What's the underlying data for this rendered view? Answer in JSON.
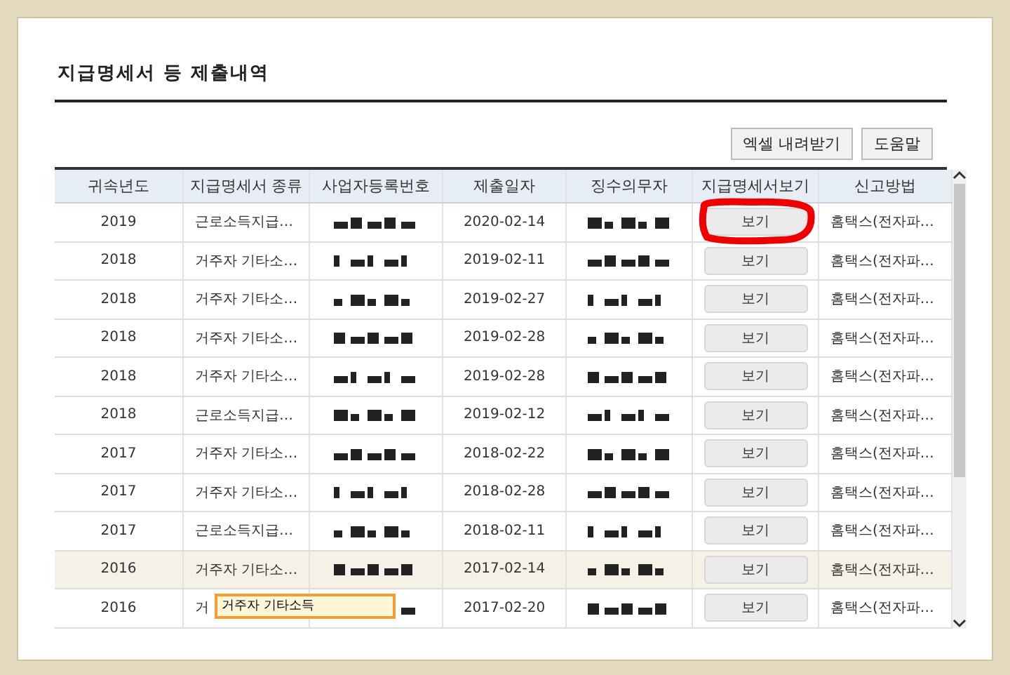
{
  "title": "지급명세서 등 제출내역",
  "buttons": [
    "엑셀 내려받기",
    "도움말"
  ],
  "table": {
    "columns": [
      "귀속년도",
      "지급명세서 종류",
      "사업자등록번호",
      "제출일자",
      "징수의무자",
      "지급명세서보기",
      "신고방법"
    ],
    "rows": [
      {
        "year": "2019",
        "type": "근로소득지급…",
        "date": "2020-02-14",
        "view": "보기",
        "method": "홈택스(전자파…",
        "highlighted": false,
        "circled": true
      },
      {
        "year": "2018",
        "type": "거주자 기타소…",
        "date": "2019-02-11",
        "view": "보기",
        "method": "홈택스(전자파…",
        "highlighted": false,
        "circled": false
      },
      {
        "year": "2018",
        "type": "거주자 기타소…",
        "date": "2019-02-27",
        "view": "보기",
        "method": "홈택스(전자파…",
        "highlighted": false,
        "circled": false
      },
      {
        "year": "2018",
        "type": "거주자 기타소…",
        "date": "2019-02-28",
        "view": "보기",
        "method": "홈택스(전자파…",
        "highlighted": false,
        "circled": false
      },
      {
        "year": "2018",
        "type": "거주자 기타소…",
        "date": "2019-02-28",
        "view": "보기",
        "method": "홈택스(전자파…",
        "highlighted": false,
        "circled": false
      },
      {
        "year": "2018",
        "type": "근로소득지급…",
        "date": "2019-02-12",
        "view": "보기",
        "method": "홈택스(전자파…",
        "highlighted": false,
        "circled": false
      },
      {
        "year": "2017",
        "type": "거주자 기타소…",
        "date": "2018-02-22",
        "view": "보기",
        "method": "홈택스(전자파…",
        "highlighted": false,
        "circled": false
      },
      {
        "year": "2017",
        "type": "거주자 기타소…",
        "date": "2018-02-28",
        "view": "보기",
        "method": "홈택스(전자파…",
        "highlighted": false,
        "circled": false
      },
      {
        "year": "2017",
        "type": "근로소득지급…",
        "date": "2018-02-11",
        "view": "보기",
        "method": "홈택스(전자파…",
        "highlighted": false,
        "circled": false
      },
      {
        "year": "2016",
        "type": "거주자 기타소…",
        "date": "2017-02-14",
        "view": "보기",
        "method": "홈택스(전자파…",
        "highlighted": true,
        "circled": false
      },
      {
        "year": "2016",
        "type": "거",
        "date": "2017-02-20",
        "view": "보기",
        "method": "홈택스(전자파…",
        "highlighted": false,
        "circled": false,
        "tooltip": "거주자 기타소득"
      }
    ]
  }
}
